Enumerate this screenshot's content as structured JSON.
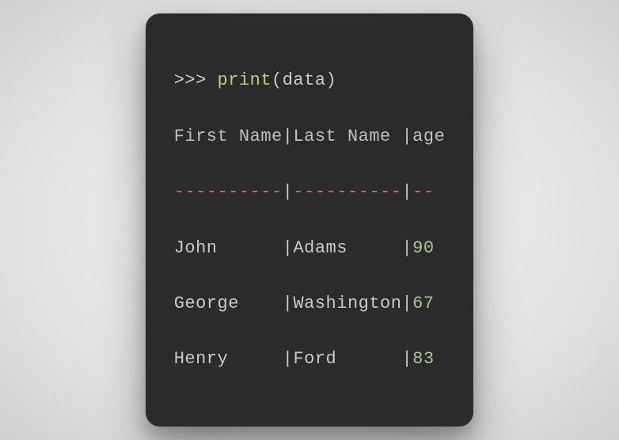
{
  "command": {
    "prompt": ">>> ",
    "function": "print",
    "open_paren": "(",
    "argument": "data",
    "close_paren": ")"
  },
  "table": {
    "header": {
      "first_pad": "First Name",
      "last_pad": "Last Name ",
      "age_pad": "age"
    },
    "separator": {
      "first": "----------",
      "last": "----------",
      "age": "--"
    },
    "rows": [
      {
        "first_pad": "John      ",
        "last_pad": "Adams     ",
        "age_pad": "90"
      },
      {
        "first_pad": "George    ",
        "last_pad": "Washington",
        "age_pad": "67"
      },
      {
        "first_pad": "Henry     ",
        "last_pad": "Ford      ",
        "age_pad": "83"
      }
    ],
    "pipe": "|"
  },
  "chart_data": {
    "type": "table",
    "columns": [
      "First Name",
      "Last Name",
      "age"
    ],
    "rows": [
      [
        "John",
        "Adams",
        90
      ],
      [
        "George",
        "Washington",
        67
      ],
      [
        "Henry",
        "Ford",
        83
      ]
    ]
  }
}
